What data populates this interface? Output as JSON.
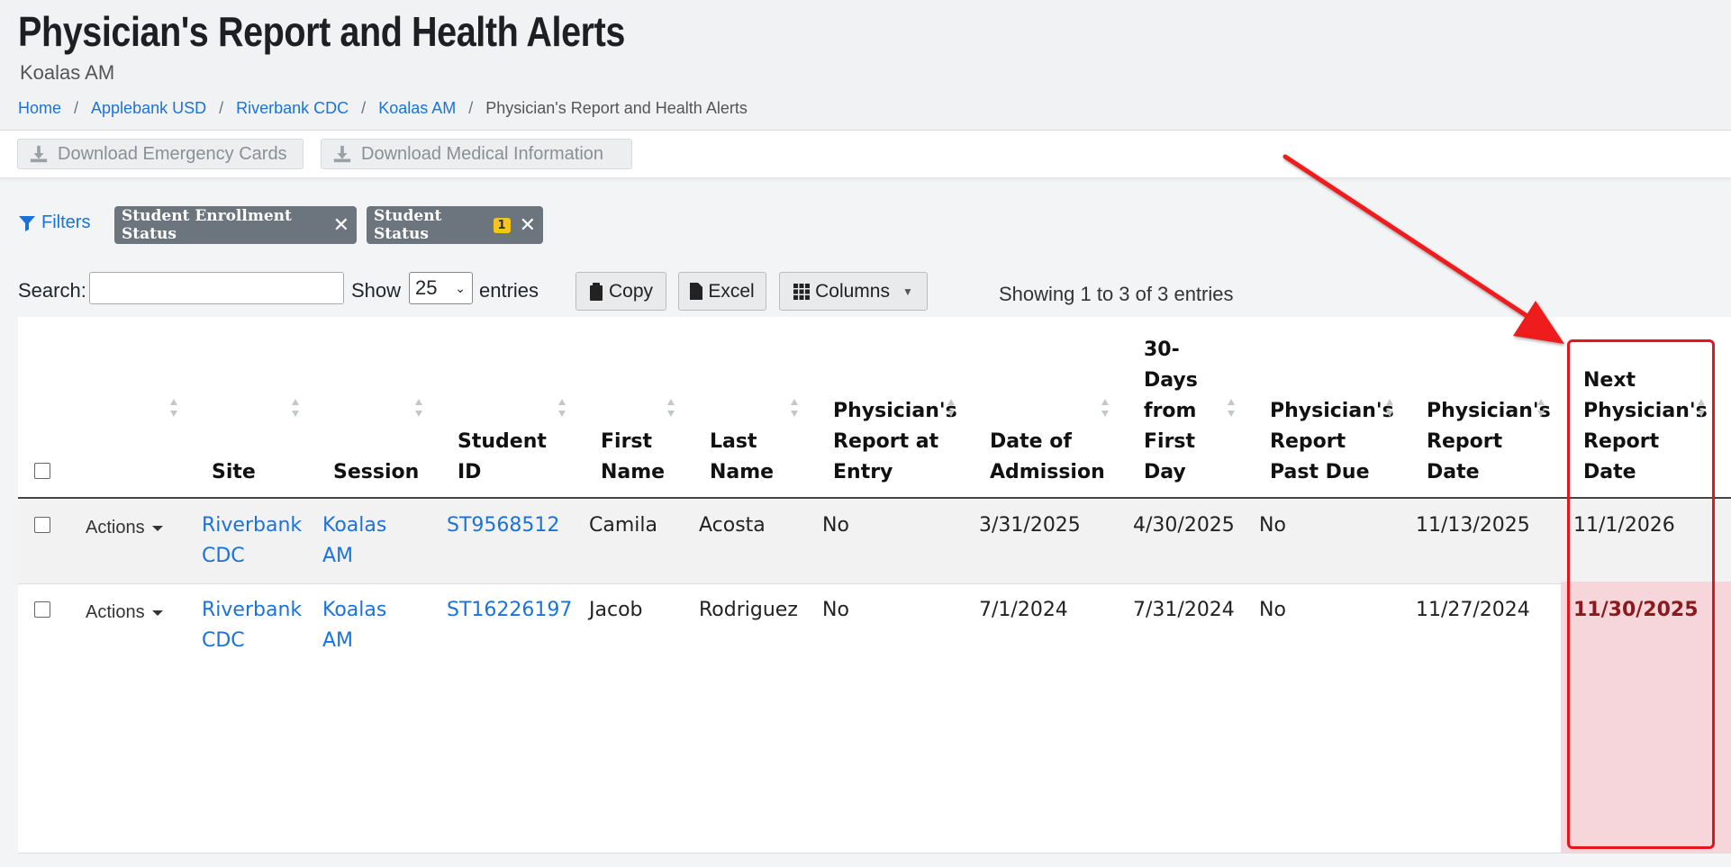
{
  "header": {
    "title": "Physician's Report and Health Alerts",
    "subtitle": "Koalas AM",
    "breadcrumb": [
      "Home",
      "Applebank USD",
      "Riverbank CDC",
      "Koalas AM",
      "Physician's Report and Health Alerts"
    ]
  },
  "toolbar": {
    "download_emergency": "Download Emergency Cards",
    "download_medical": "Download Medical Information"
  },
  "filters": {
    "label": "Filters",
    "chips": [
      {
        "label": "Student Enrollment Status",
        "badge": ""
      },
      {
        "label": "Student Status",
        "badge": "1"
      }
    ]
  },
  "controls": {
    "search_label": "Search:",
    "search_value": "",
    "show_label": "Show",
    "page_size": "25",
    "entries_label": "entries",
    "copy": "Copy",
    "excel": "Excel",
    "columns": "Columns",
    "info": "Showing 1 to 3 of 3 entries"
  },
  "table": {
    "columns": [
      {
        "lines": [
          ""
        ]
      },
      {
        "lines": [
          "Site"
        ]
      },
      {
        "lines": [
          "Session"
        ]
      },
      {
        "lines": [
          "Student",
          "ID"
        ]
      },
      {
        "lines": [
          "First",
          "Name"
        ]
      },
      {
        "lines": [
          "Last",
          "Name"
        ]
      },
      {
        "lines": [
          "Physician's",
          "Report at",
          "Entry"
        ]
      },
      {
        "lines": [
          "Date of",
          "Admission"
        ]
      },
      {
        "lines": [
          "30-",
          "Days",
          "from",
          "First",
          "Day"
        ]
      },
      {
        "lines": [
          "Physician's",
          "Report",
          "Past Due"
        ]
      },
      {
        "lines": [
          "Physician's",
          "Report",
          "Date"
        ]
      },
      {
        "lines": [
          "Next",
          "Physician's",
          "Report",
          "Date"
        ]
      }
    ],
    "rows": [
      {
        "actions": "Actions",
        "site": [
          "Riverbank",
          "CDC"
        ],
        "session": [
          "Koalas",
          "AM"
        ],
        "student_id": "ST9568512",
        "first_name": "Camila",
        "last_name": "Acosta",
        "report_at_entry": "No",
        "date_of_admission": "3/31/2025",
        "days_30": "4/30/2025",
        "past_due": "No",
        "report_date": "11/13/2025",
        "next_report_date": "11/1/2026",
        "overdue": false
      },
      {
        "actions": "Actions",
        "site": [
          "Riverbank",
          "CDC"
        ],
        "session": [
          "Koalas",
          "AM"
        ],
        "student_id": "ST16226197",
        "first_name": "Jacob",
        "last_name": "Rodriguez",
        "report_at_entry": "No",
        "date_of_admission": "7/1/2024",
        "days_30": "7/31/2024",
        "past_due": "No",
        "report_date": "11/27/2024",
        "next_report_date": "11/30/2025",
        "overdue": true
      }
    ]
  },
  "colors": {
    "link": "#1a73d9",
    "annotation": "#e8141c",
    "overdue_bg": "#f6d6da",
    "overdue_text": "#8b1a1e"
  }
}
